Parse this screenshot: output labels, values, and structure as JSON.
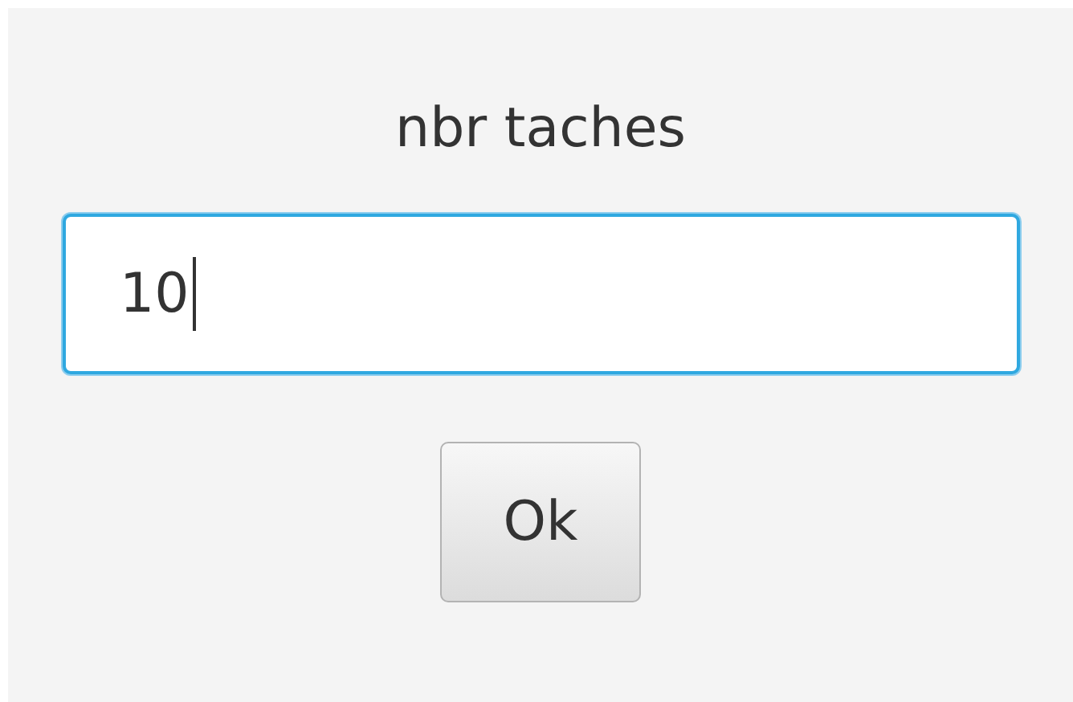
{
  "title": "nbr taches",
  "field": {
    "value": "10",
    "focused": true
  },
  "buttons": [
    "Ok"
  ]
}
